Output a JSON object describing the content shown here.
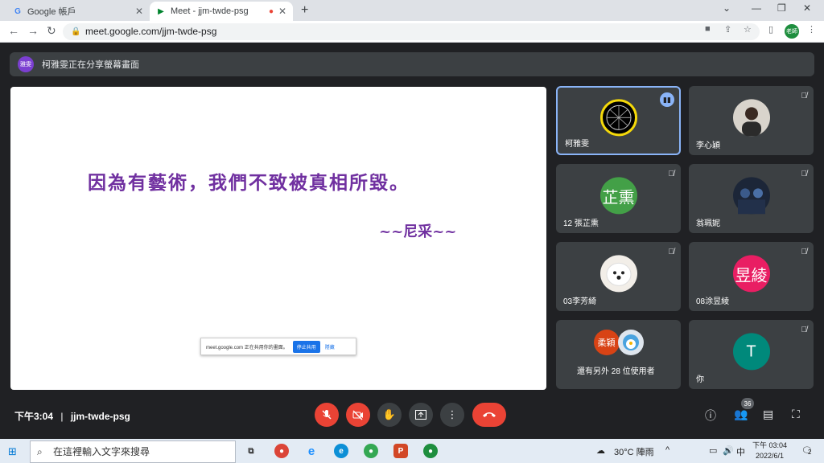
{
  "browser": {
    "tabs": [
      {
        "title": "Google 帳戶"
      },
      {
        "title": "Meet - jjm-twde-psg"
      }
    ],
    "url": "meet.google.com/jjm-twde-psg",
    "profile": "老師"
  },
  "banner": {
    "avatar": "雅雯",
    "text": "柯雅雯正在分享螢幕畫面"
  },
  "presentation": {
    "quote": "因為有藝術，我們不致被真相所毀。",
    "author": "~~尼采~~",
    "share_bar": {
      "text": "meet.google.com 正在共用你的畫面。",
      "stop": "停止共用",
      "hide": "隱藏"
    }
  },
  "participants": [
    {
      "name": "柯雅雯",
      "initials": "",
      "color": "#000000",
      "speaking": true
    },
    {
      "name": "李心穎",
      "initials": "",
      "color": "#c8c8c8",
      "speaking": false
    },
    {
      "name": "12 張芷熏",
      "initials": "芷熏",
      "color": "#43a047",
      "speaking": false
    },
    {
      "name": "翁珮妮",
      "initials": "",
      "color": "#2b3a55",
      "speaking": false
    },
    {
      "name": "03李芳綺",
      "initials": "",
      "color": "#e0d8cc",
      "speaking": false
    },
    {
      "name": "08涂昱綾",
      "initials": "昱綾",
      "color": "#e91e63",
      "speaking": false
    },
    {
      "name": "還有另外 28 位使用者",
      "initials": "柔穎",
      "color": "#d84315",
      "speaking": false
    },
    {
      "name": "你",
      "initials": "T",
      "color": "#00897b",
      "speaking": false
    }
  ],
  "meeting": {
    "time": "下午3:04",
    "separator": "|",
    "code": "jjm-twde-psg",
    "participant_count": "36"
  },
  "taskbar": {
    "search_placeholder": "在這裡輸入文字來搜尋",
    "weather": "30°C 陣雨",
    "ime": "中",
    "clock_time": "下午 03:04",
    "clock_date": "2022/6/1",
    "notifications": "2"
  },
  "colors": {
    "accent": "#8ab4f8",
    "danger": "#ea4335",
    "quote": "#7030a0"
  }
}
